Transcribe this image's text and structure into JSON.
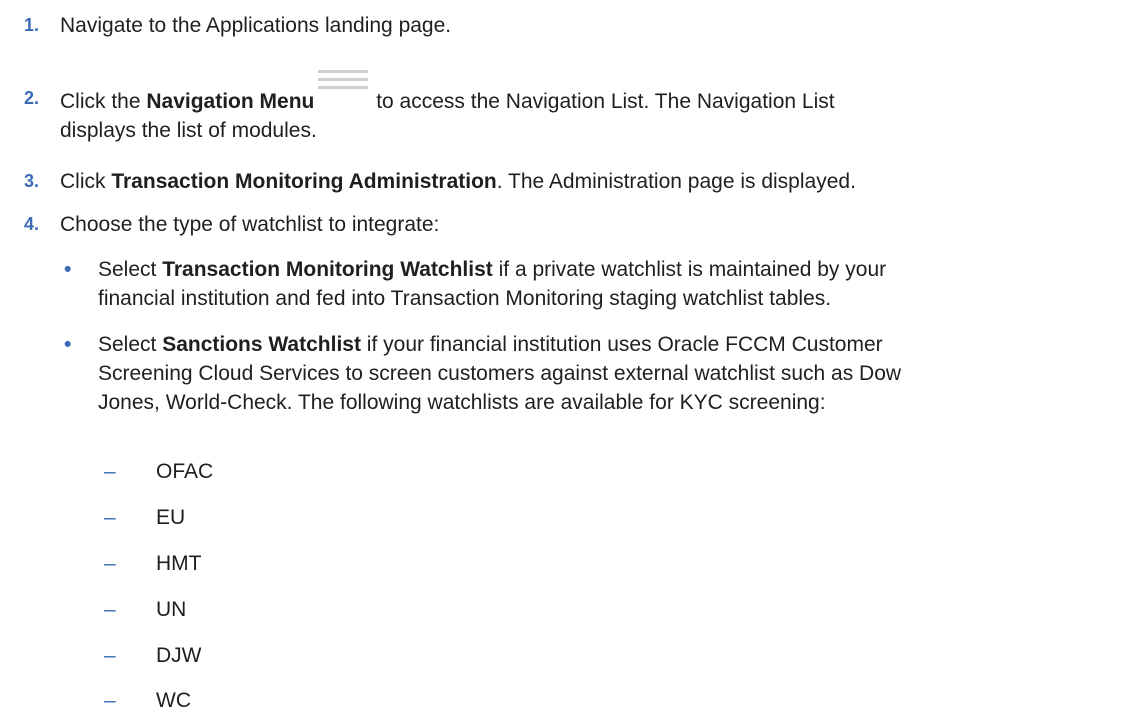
{
  "steps": [
    {
      "num": "1.",
      "text": "Navigate to the Applications landing page."
    },
    {
      "num": "2.",
      "pre": "Click the ",
      "bold": "Navigation Menu",
      "post1": " to access the Navigation List. The Navigation List",
      "post2": "displays the list of modules."
    },
    {
      "num": "3.",
      "pre": "Click ",
      "bold": "Transaction Monitoring Administration",
      "post": ". The Administration page is displayed."
    },
    {
      "num": "4.",
      "text": "Choose the type of watchlist to integrate:"
    }
  ],
  "bullets": [
    {
      "marker": "•",
      "pre": "Select ",
      "bold": "Transaction Monitoring Watchlist",
      "line1": " if a private watchlist is maintained by your",
      "line2": "financial institution and fed into Transaction Monitoring staging watchlist tables."
    },
    {
      "marker": "•",
      "pre": "Select ",
      "bold": "Sanctions Watchlist",
      "line1": " if your financial institution uses Oracle FCCM Customer",
      "line2": "Screening Cloud Services to screen customers against external watchlist such as Dow",
      "line3": "Jones, World-Check. The following watchlists are available for KYC screening:"
    }
  ],
  "watchlists": [
    "OFAC",
    "EU",
    "HMT",
    "UN",
    "DJW",
    "WC"
  ],
  "dash_marker": "–",
  "icons": {
    "menu": "hamburger-menu-icon"
  }
}
